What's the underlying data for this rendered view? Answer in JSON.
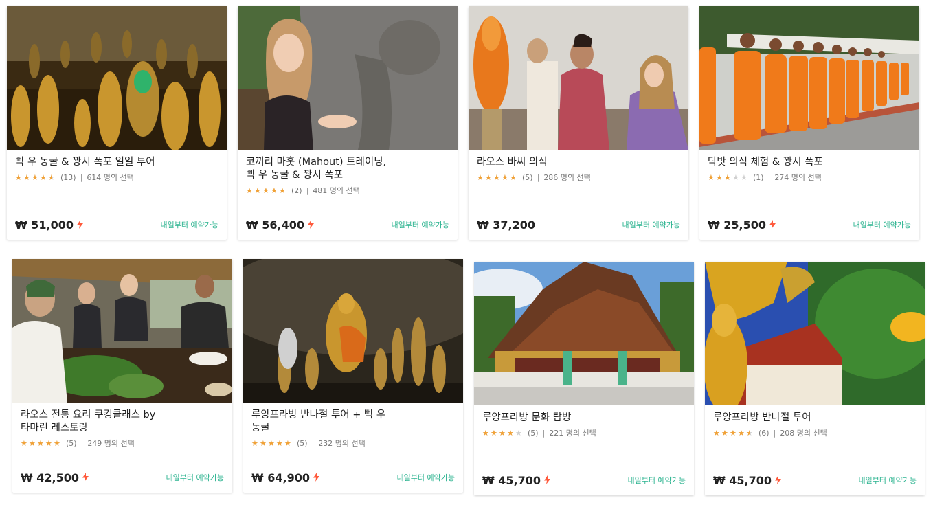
{
  "colors": {
    "star": "#f2a134",
    "star_empty": "#d0d0d0",
    "avail": "#2bb38f",
    "bolt": "#ff5a3c"
  },
  "cards": [
    {
      "title": "빡 우 동굴 & 꽝시 폭포 일일 투어",
      "rating": 4.5,
      "reviews": "(13)",
      "chosen": "614 명의 선택",
      "price": "₩ 51,000",
      "availability": "내일부터 예약가능",
      "bolt_icon": "lightning-icon",
      "image": "buddha-cave-photo"
    },
    {
      "title": "코끼리 마훗 (Mahout) 트레이닝,\n빡 우 동굴 & 꽝시 폭포",
      "rating": 5,
      "reviews": "(2)",
      "chosen": "481 명의 선택",
      "price": "₩ 56,400",
      "availability": "내일부터 예약가능",
      "bolt_icon": "lightning-icon",
      "image": "elephant-photo"
    },
    {
      "title": "라오스 바씨 의식",
      "rating": 5,
      "reviews": "(5)",
      "chosen": "286 명의 선택",
      "price": "₩ 37,200",
      "availability": "내일부터 예약가능",
      "bolt_icon": "lightning-icon",
      "image": "baci-ceremony-photo"
    },
    {
      "title": "탁밧 의식 체험 & 꽝시 폭포",
      "rating": 3,
      "reviews": "(1)",
      "chosen": "274 명의 선택",
      "price": "₩ 25,500",
      "availability": "내일부터 예약가능",
      "bolt_icon": "lightning-icon",
      "image": "monks-alms-photo"
    },
    {
      "title": "라오스 전통 요리 쿠킹클래스 by\n타마린 레스토랑",
      "rating": 5,
      "reviews": "(5)",
      "chosen": "249 명의 선택",
      "price": "₩ 42,500",
      "availability": "내일부터 예약가능",
      "bolt_icon": "lightning-icon",
      "image": "cooking-class-photo"
    },
    {
      "title": "루앙프라방 반나절 투어 + 빡 우\n동굴",
      "rating": 5,
      "reviews": "(5)",
      "chosen": "232 명의 선택",
      "price": "₩ 64,900",
      "availability": "내일부터 예약가능",
      "bolt_icon": "lightning-icon",
      "image": "cave-buddha-statues-photo"
    },
    {
      "title": "루앙프라방 문화 탐방",
      "rating": 4,
      "reviews": "(5)",
      "chosen": "221 명의 선택",
      "price": "₩ 45,700",
      "availability": "내일부터 예약가능",
      "bolt_icon": "lightning-icon",
      "image": "temple-photo"
    },
    {
      "title": "루앙프라방 반나절 투어",
      "rating": 4.5,
      "reviews": "(6)",
      "chosen": "208 명의 선택",
      "price": "₩ 45,700",
      "availability": "내일부터 예약가능",
      "bolt_icon": "lightning-icon",
      "image": "golden-buddha-naga-photo"
    }
  ]
}
